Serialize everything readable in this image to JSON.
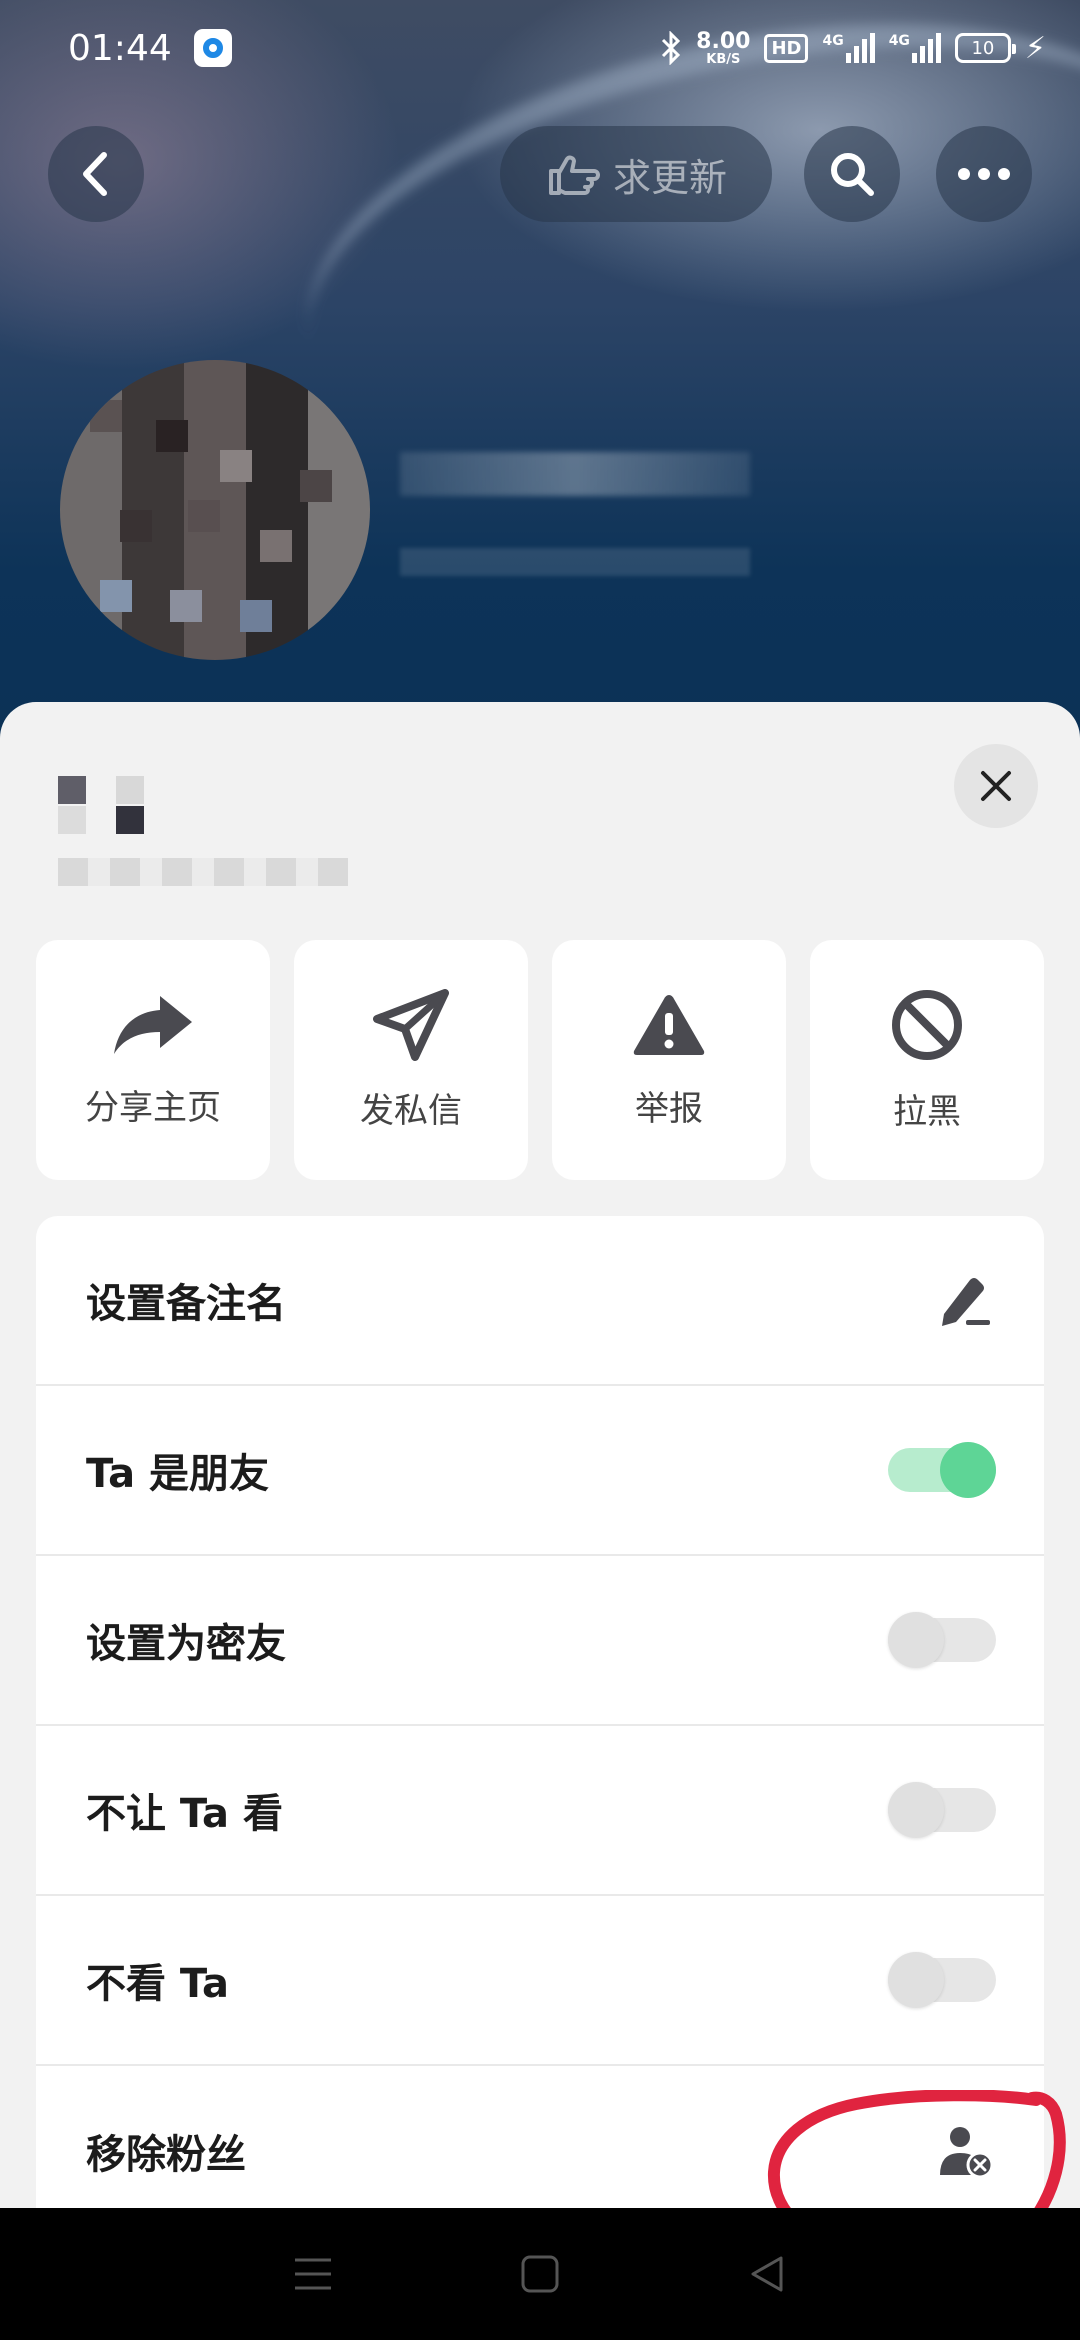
{
  "status_bar": {
    "time": "01:44",
    "net_speed_value": "8.00",
    "net_speed_unit": "KB/S",
    "hd_badge": "HD",
    "signal1_tag": "4G",
    "signal2_tag": "4G",
    "battery": "10"
  },
  "header": {
    "follow_button_label": "求更新"
  },
  "actions": [
    {
      "label": "分享主页",
      "icon": "share-icon"
    },
    {
      "label": "发私信",
      "icon": "send-icon"
    },
    {
      "label": "举报",
      "icon": "warning-icon"
    },
    {
      "label": "拉黑",
      "icon": "block-icon"
    }
  ],
  "settings": [
    {
      "label": "设置备注名",
      "control": "edit-icon"
    },
    {
      "label": "Ta 是朋友",
      "control": "toggle",
      "on": true
    },
    {
      "label": "设置为密友",
      "control": "toggle",
      "on": false
    },
    {
      "label": "不让 Ta 看",
      "control": "toggle",
      "on": false
    },
    {
      "label": "不看 Ta",
      "control": "toggle",
      "on": false
    },
    {
      "label": "移除粉丝",
      "control": "remove-follower-icon"
    }
  ],
  "colors": {
    "toggle_on": "#5ed596",
    "annotation": "#e0243f"
  }
}
